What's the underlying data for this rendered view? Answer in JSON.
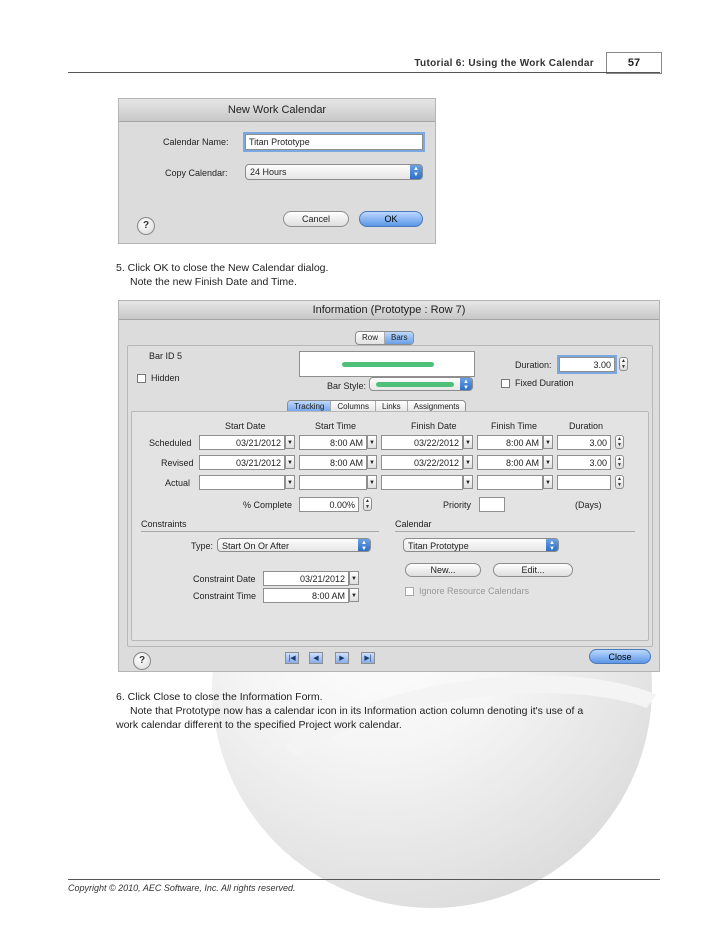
{
  "header": {
    "title": "Tutorial 6: Using the Work Calendar",
    "page": "57"
  },
  "footer": {
    "copyright": "Copyright © 2010, AEC Software, Inc. All rights reserved."
  },
  "dialog1": {
    "title": "New Work Calendar",
    "name_label": "Calendar Name:",
    "name_value": "Titan Prototype",
    "copy_label": "Copy Calendar:",
    "copy_value": "24 Hours",
    "help": "?",
    "cancel": "Cancel",
    "ok": "OK"
  },
  "step5": {
    "line1": "5. Click OK to close the New Calendar dialog.",
    "line2": "Note the new Finish Date and Time."
  },
  "dialog2": {
    "title": "Information (Prototype : Row 7)",
    "seg_row": "Row",
    "seg_bars": "Bars",
    "bar_id": "Bar ID 5",
    "hidden": "Hidden",
    "duration_label": "Duration:",
    "duration_value": "3.00",
    "fixed_duration": "Fixed Duration",
    "bar_style_label": "Bar Style:",
    "tabs": [
      "Tracking",
      "Columns",
      "Links",
      "Assignments"
    ],
    "cols": {
      "start_date": "Start Date",
      "start_time": "Start Time",
      "finish_date": "Finish Date",
      "finish_time": "Finish Time",
      "duration": "Duration"
    },
    "rows": [
      {
        "label": "Scheduled",
        "start_date": "03/21/2012",
        "start_time": "8:00 AM",
        "finish_date": "03/22/2012",
        "finish_time": "8:00 AM",
        "duration": "3.00"
      },
      {
        "label": "Revised",
        "start_date": "03/21/2012",
        "start_time": "8:00 AM",
        "finish_date": "03/22/2012",
        "finish_time": "8:00 AM",
        "duration": "3.00"
      },
      {
        "label": "Actual",
        "start_date": "",
        "start_time": "",
        "finish_date": "",
        "finish_time": "",
        "duration": ""
      }
    ],
    "pct_label": "% Complete",
    "pct_value": "0.00%",
    "priority_label": "Priority",
    "days": "(Days)",
    "constraints_label": "Constraints",
    "calendar_label": "Calendar",
    "type_label": "Type:",
    "type_value": "Start On Or After",
    "calendar_value": "Titan Prototype",
    "new_btn": "New...",
    "edit_btn": "Edit...",
    "constraint_date_label": "Constraint Date",
    "constraint_date_value": "03/21/2012",
    "constraint_time_label": "Constraint Time",
    "constraint_time_value": "8:00 AM",
    "ignore_resource": "Ignore Resource Calendars",
    "help": "?",
    "close": "Close"
  },
  "step6": {
    "line1": "6. Click Close to close the Information Form.",
    "line2": "Note that Prototype now has a calendar icon in its Information action column denoting it's use of a",
    "line3": "work calendar different to the specified Project work calendar."
  }
}
